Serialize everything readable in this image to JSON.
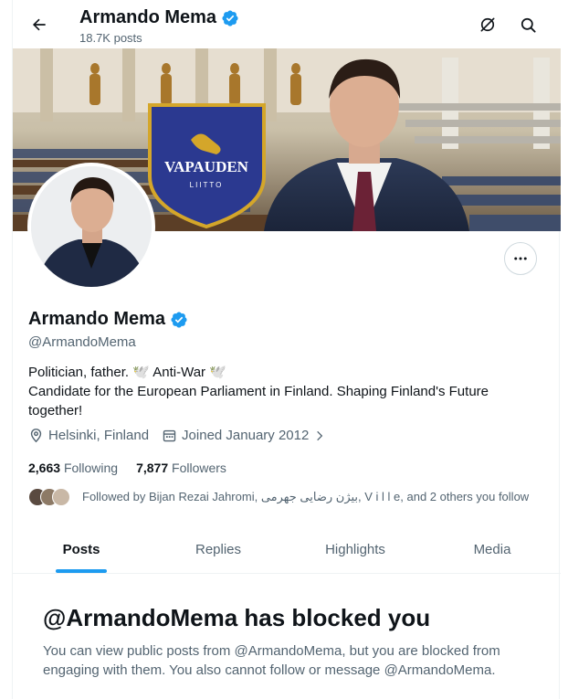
{
  "header": {
    "name": "Armando Mema",
    "posts_count": "18.7K posts"
  },
  "profile": {
    "name": "Armando Mema",
    "handle": "@ArmandoMema",
    "bio_line1": "Politician, father. 🕊️ Anti-War 🕊️",
    "bio_line2": "Candidate for the European Parliament in Finland. Shaping Finland's Future together!",
    "location": "Helsinki, Finland",
    "joined": "Joined January 2012",
    "following_count": "2,663",
    "following_label": "Following",
    "followers_count": "7,877",
    "followers_label": "Followers",
    "followed_by": "Followed by Bijan Rezai Jahromi, بیژن رضایی جهرمی, V i l l e, and 2 others you follow"
  },
  "banner": {
    "shield_text": "VAPAUDEN",
    "shield_sub": "LIITTO"
  },
  "tabs": [
    {
      "label": "Posts",
      "active": true
    },
    {
      "label": "Replies",
      "active": false
    },
    {
      "label": "Highlights",
      "active": false
    },
    {
      "label": "Media",
      "active": false
    }
  ],
  "blocked": {
    "title": "@ArmandoMema has blocked you",
    "message": "You can view public posts from @ArmandoMema, but you are blocked from engaging with them. You also cannot follow or message @ArmandoMema."
  },
  "colors": {
    "accent": "#1d9bf0",
    "verified": "#1d9bf0",
    "text_secondary": "#536471"
  },
  "icons": [
    "back-arrow-icon",
    "grok-icon",
    "search-icon",
    "more-icon",
    "verified-badge-icon",
    "location-pin-icon",
    "calendar-icon",
    "chevron-right-icon"
  ]
}
